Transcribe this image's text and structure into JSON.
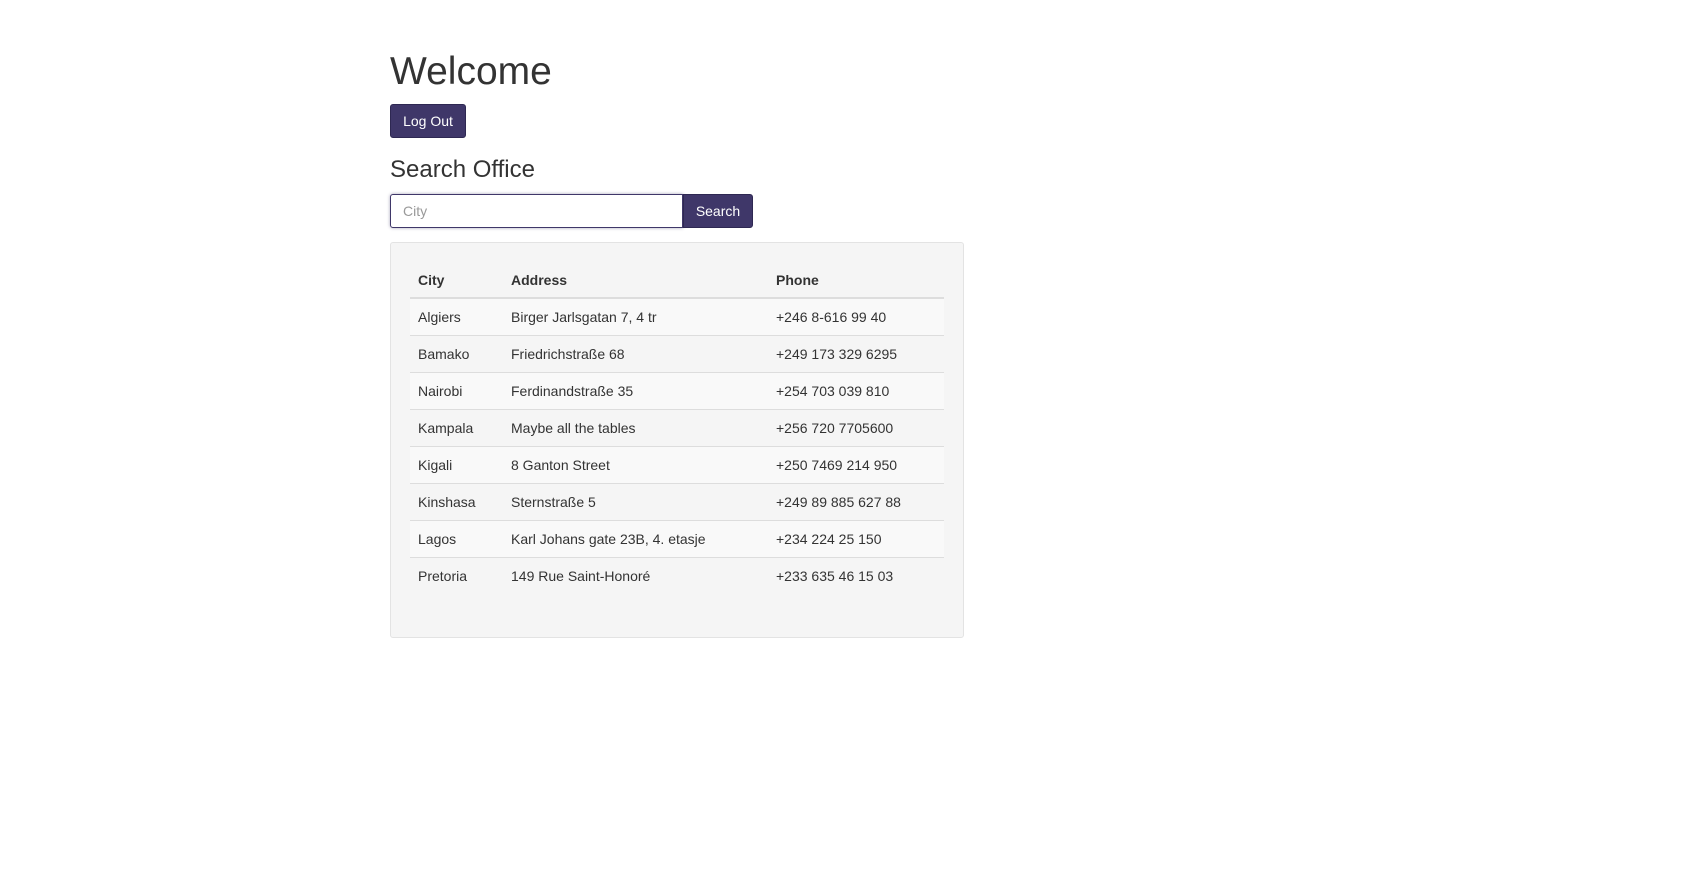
{
  "header": {
    "title": "Welcome",
    "logout_label": "Log Out"
  },
  "search": {
    "heading": "Search Office",
    "placeholder": "City",
    "value": "",
    "button_label": "Search"
  },
  "table": {
    "headers": [
      "City",
      "Address",
      "Phone"
    ],
    "rows": [
      [
        "Algiers",
        "Birger Jarlsgatan 7, 4 tr",
        "+246 8-616 99 40"
      ],
      [
        "Bamako",
        "Friedrichstraße 68",
        "+249 173 329 6295"
      ],
      [
        "Nairobi",
        "Ferdinandstraße 35",
        "+254 703 039 810"
      ],
      [
        "Kampala",
        "Maybe all the tables",
        "+256 720 7705600"
      ],
      [
        "Kigali",
        "8 Ganton Street",
        "+250 7469 214 950"
      ],
      [
        "Kinshasa",
        "Sternstraße 5",
        "+249 89 885 627 88"
      ],
      [
        "Lagos",
        "Karl Johans gate 23B, 4. etasje",
        "+234 224 25 150"
      ],
      [
        "Pretoria",
        "149 Rue Saint-Honoré",
        "+233 635 46 15 03"
      ]
    ]
  },
  "colors": {
    "accent": "#3f3769",
    "well_background": "#f5f5f5",
    "stripe": "#f9f9f9"
  }
}
